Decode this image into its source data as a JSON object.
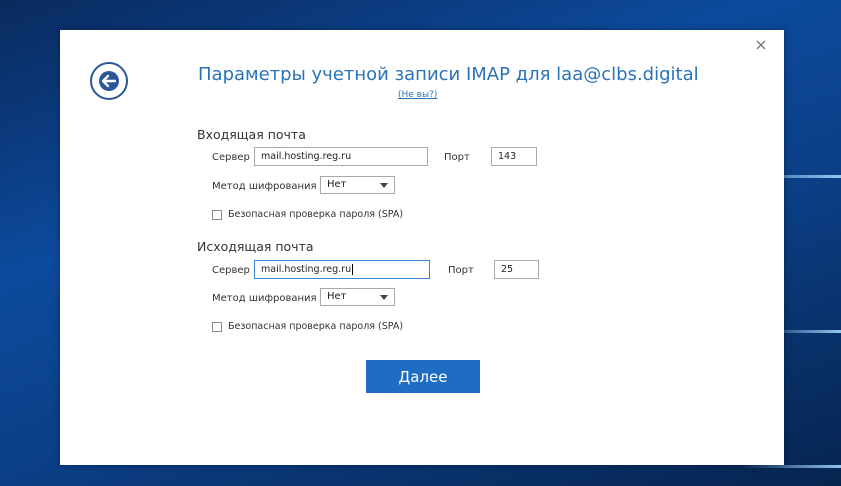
{
  "dialog": {
    "close_glyph": "×",
    "title": "Параметры учетной записи IMAP для laa@clbs.digital",
    "not_you_link": "(Не вы?)",
    "next_button": "Далее"
  },
  "incoming": {
    "heading": "Входящая почта",
    "server_label": "Сервер",
    "server_value": "mail.hosting.reg.ru",
    "port_label": "Порт",
    "port_value": "143",
    "encryption_label": "Метод шифрования",
    "encryption_value": "Нет",
    "spa_label": "Безопасная проверка пароля (SPA)",
    "spa_checked": false
  },
  "outgoing": {
    "heading": "Исходящая почта",
    "server_label": "Сервер",
    "server_value": "mail.hosting.reg.ru",
    "port_label": "Порт",
    "port_value": "25",
    "encryption_label": "Метод шифрования",
    "encryption_value": "Нет",
    "spa_label": "Безопасная проверка пароля (SPA)",
    "spa_checked": false
  },
  "colors": {
    "accent": "#2b72b8",
    "button": "#1f6cc4",
    "back_icon": "#2b5797"
  },
  "icons": {
    "back": "back-arrow-icon",
    "close": "close-icon",
    "dropdown": "chevron-down-icon"
  }
}
